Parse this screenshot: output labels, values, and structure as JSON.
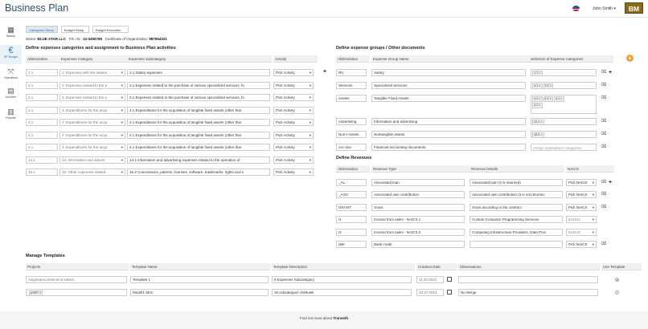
{
  "app": {
    "title": "Business Plan",
    "user": "John Smith ▾",
    "logo": "BM"
  },
  "sidebar": [
    {
      "icon": "startup-icon",
      "label": "Startup",
      "glyph": "▦"
    },
    {
      "icon": "euro-icon",
      "label": "BP Budget",
      "glyph": "€",
      "active": true
    },
    {
      "icon": "operations-icon",
      "label": "Operations",
      "glyph": "⤧"
    },
    {
      "icon": "archive-icon",
      "label": "Archives",
      "glyph": "▤"
    },
    {
      "icon": "reports-icon",
      "label": "Reports",
      "glyph": "▥"
    }
  ],
  "tabs": [
    "Categories Setup",
    "Budget Setup",
    "Budget Execution"
  ],
  "info": {
    "name_label": "Name:",
    "name": "BLUE STAR LLC",
    "feil_label": "F.E.I.N.:",
    "feil": "12-3456789",
    "cert_label": "Certificate of Organization:",
    "cert": "987654321"
  },
  "left": {
    "title": "Define expenses categories and assignment to Business Plan activities",
    "headers": [
      "Abbreviation",
      "Expenses Category",
      "Expenses Subcategory",
      "Activity"
    ],
    "rows": [
      {
        "abbr": "1.1",
        "cat": "1. Expenses with the salarie",
        "sub": "1.1 Salary expenses",
        "act": "Pick Activity"
      },
      {
        "abbr": "3.1",
        "cat": "3. Expenses related to the p",
        "sub": "3.1 Expenses related to the purchase of various specialized services, fo",
        "act": "Pick Activity"
      },
      {
        "abbr": "3.1",
        "cat": "3. Expenses related to the p",
        "sub": "3.1 Expenses related to the purchase of various specialized services, fo",
        "act": "Pick Activity"
      },
      {
        "abbr": "4.1",
        "cat": "4. Expenditures for the acqu",
        "sub": "4.1 Expenditures for the acquisition of tangible fixed assets (other thar",
        "act": "Pick Activity"
      },
      {
        "abbr": "4.1",
        "cat": "4. Expenditures for the acqu",
        "sub": "4.1 Expenditures for the acquisition of tangible fixed assets (other thar",
        "act": "Pick Activity"
      },
      {
        "abbr": "4.1",
        "cat": "4. Expenditures for the acqu",
        "sub": "4.1 Expenditures for the acquisition of tangible fixed assets (other thar",
        "act": "Pick Activity"
      },
      {
        "abbr": "4.1",
        "cat": "4. Expenditures for the acqu",
        "sub": "4.1 Expenditures for the acquisition of tangible fixed assets (other thar",
        "act": "Pick Activity"
      },
      {
        "abbr": "14.1",
        "cat": "14. Information and adverti",
        "sub": "14.1 Information and advertising expenses related to the operation of",
        "act": "Pick Activity"
      },
      {
        "abbr": "15.4",
        "cat": "15. Other expenses related",
        "sub": "15.4 Concessions, patents, licenses, software, trademarks, rights and s",
        "act": "Pick Activity"
      }
    ]
  },
  "groups": {
    "title": "Define expense groups / Other documents",
    "headers": [
      "Abbreviation",
      "Expense Group Name",
      "Selection of Expense Categories"
    ],
    "rows": [
      {
        "abbr": "RU",
        "name": "Salary",
        "chips": [
          "1.1"
        ],
        "placeholder": ""
      },
      {
        "abbr": "Services",
        "name": "Specialized Services",
        "chips": [
          "3.1",
          "3.1"
        ],
        "placeholder": ""
      },
      {
        "abbr": "Assets",
        "name": "Tangible Fixed Assets",
        "chips": [
          "4.1",
          "4.1",
          "4.1",
          "4.1"
        ],
        "placeholder": ""
      },
      {
        "abbr": "Advertising",
        "name": "Information and advertising",
        "chips": [
          "14.1"
        ],
        "placeholder": ""
      },
      {
        "abbr": "Non-t Assets",
        "name": "Nontangible assets",
        "chips": [
          "15.4"
        ],
        "placeholder": ""
      },
      {
        "abbr": "Acc-doc",
        "name": "Financial accounting documents",
        "chips": [],
        "placeholder": "Assign expenditure categories"
      }
    ]
  },
  "revenues": {
    "title": "Define Revenues",
    "headers": [
      "Abbreviation",
      "Revenue Type",
      "Revenue Details",
      "NAICS"
    ],
    "rows": [
      {
        "abbr": "_AL",
        "type": "Associated loan",
        "details": "Associated loan (it is returned)",
        "naics": "Pick NAICS"
      },
      {
        "abbr": "_AOC",
        "type": "Associated own contribution",
        "details": "Associated own contribution (it is not returnec",
        "naics": "Pick NAICS"
      },
      {
        "abbr": "GRANT",
        "type": "Grant",
        "details": "Grant according to the contract",
        "naics": "Pick NAICS"
      },
      {
        "abbr": "I1",
        "type": "Income from sales - NAICS 1",
        "details": "Custom Computer Programming Services",
        "naics": "541511"
      },
      {
        "abbr": "I2",
        "type": "Income from sales - NAICS 2",
        "details": "Computing Infrastructure Providers, Data Proc",
        "naics": "518210"
      },
      {
        "abbr": "xBK",
        "type": "Bank credit",
        "details": "",
        "naics": "Pick NAICS"
      }
    ]
  },
  "templates": {
    "title": "Manage Templates",
    "headers": [
      "Projects",
      "Template Name",
      "Template Description",
      "Creation Date",
      "Observations",
      "Use Template"
    ],
    "rows": [
      {
        "project": "Asigneaza proiecte la sablon",
        "project_chip": "",
        "name": "Template 1",
        "desc": "5 Expenses Subcategory",
        "date": "11.20.2022",
        "obs": "",
        "selected": true
      },
      {
        "project": "",
        "project_chip": "pSEP",
        "name": "Model1 SES",
        "desc": "15 subcategorii cheltuieli",
        "date": "10.27.2021",
        "obs": "Nu sterge",
        "selected": false
      }
    ]
  },
  "footer": {
    "text": "Find out more about",
    "brand": "Transeth"
  }
}
